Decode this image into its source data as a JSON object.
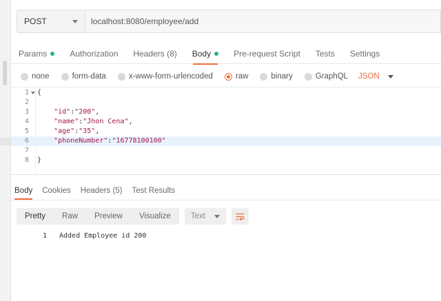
{
  "request": {
    "method": "POST",
    "url": "localhost:8080/employee/add"
  },
  "request_tabs": [
    {
      "label": "Params",
      "dot": true
    },
    {
      "label": "Authorization",
      "dot": false
    },
    {
      "label": "Headers (8)",
      "dot": false
    },
    {
      "label": "Body",
      "dot": true,
      "active": true
    },
    {
      "label": "Pre-request Script",
      "dot": false
    },
    {
      "label": "Tests",
      "dot": false
    },
    {
      "label": "Settings",
      "dot": false
    }
  ],
  "body_types": {
    "none": "none",
    "form_data": "form-data",
    "urlencoded": "x-www-form-urlencoded",
    "raw": "raw",
    "binary": "binary",
    "graphql": "GraphQL",
    "selected": "raw",
    "language": "JSON"
  },
  "editor": {
    "line_numbers": [
      "1",
      "2",
      "3",
      "4",
      "5",
      "6",
      "7",
      "8"
    ],
    "highlighted_line": "6",
    "lines": {
      "l1": "{",
      "l3_key": "\"id\"",
      "l3_val": "\"200\"",
      "l4_key": "\"name\"",
      "l4_val": "\"Jhon Cena\"",
      "l5_key": "\"age\"",
      "l5_val": "\"35\"",
      "l6_key": "\"phoneNumber\"",
      "l6_val": "\"16778100100\"",
      "l8": "}"
    }
  },
  "response_tabs": [
    {
      "label": "Body",
      "active": true
    },
    {
      "label": "Cookies"
    },
    {
      "label": "Headers (5)"
    },
    {
      "label": "Test Results"
    }
  ],
  "response_toolbar": {
    "modes": [
      "Pretty",
      "Raw",
      "Preview",
      "Visualize"
    ],
    "active_mode": "Pretty",
    "format": "Text"
  },
  "response_body": {
    "line_number": "1",
    "text": "Added Employee id 200"
  },
  "colors": {
    "accent": "#f26b3a",
    "dot_green": "#26b47f",
    "string": "#a1184a"
  }
}
